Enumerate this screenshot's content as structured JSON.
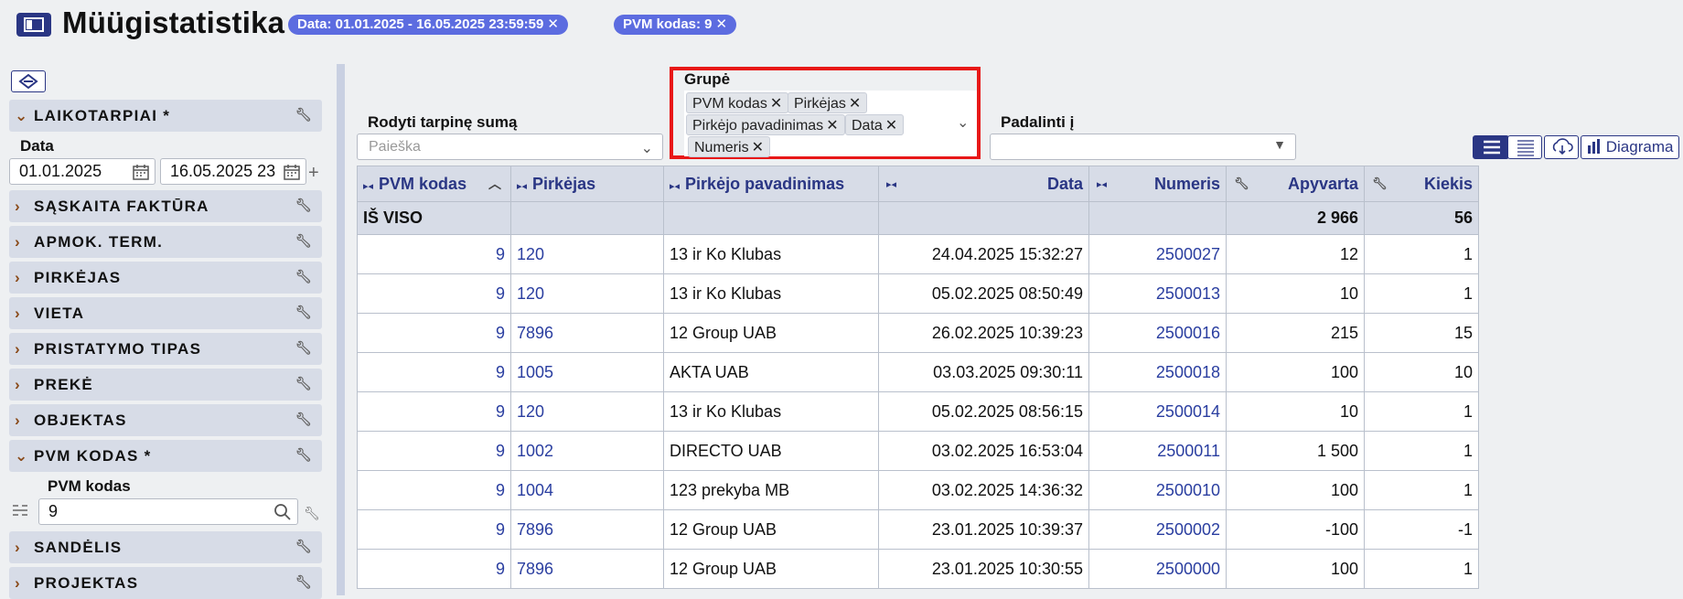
{
  "header": {
    "title": "Müügistatistika",
    "filters": [
      "Data: 01.01.2025 - 16.05.2025 23:59:59",
      "PVM kodas: 9"
    ],
    "chip_close": "✕"
  },
  "sidebar": {
    "sections": [
      {
        "label": "LAIKOTARPIAI *",
        "expanded": true
      },
      {
        "label": "SĄSKAITA FAKTŪRA",
        "expanded": false
      },
      {
        "label": "APMOK. TERM.",
        "expanded": false
      },
      {
        "label": "PIRKĖJAS",
        "expanded": false
      },
      {
        "label": "VIETA",
        "expanded": false
      },
      {
        "label": "PRISTATYMO TIPAS",
        "expanded": false
      },
      {
        "label": "PREKĖ",
        "expanded": false
      },
      {
        "label": "OBJEKTAS",
        "expanded": false
      },
      {
        "label": "PVM KODAS *",
        "expanded": true
      },
      {
        "label": "SANDĖLIS",
        "expanded": false
      },
      {
        "label": "PROJEKTAS",
        "expanded": false
      }
    ],
    "date_label": "Data",
    "date_from": "01.01.2025",
    "date_to": "16.05.2025 23",
    "pvm_label": "PVM kodas",
    "pvm_value": "9"
  },
  "controls": {
    "subtotal_label": "Rodyti tarpinę sumą",
    "subtotal_placeholder": "Paieška",
    "group_label": "Grupė",
    "group_tags": [
      "PVM kodas",
      "Pirkėjas",
      "Pirkėjo pavadinimas",
      "Data",
      "Numeris"
    ],
    "split_label": "Padalinti į",
    "diagram_label": "Diagrama"
  },
  "table": {
    "columns": [
      "PVM kodas",
      "Pirkėjas",
      "Pirkėjo pavadinimas",
      "Data",
      "Numeris",
      "Apyvarta",
      "Kiekis"
    ],
    "totals": {
      "label": "IŠ VISO",
      "apyvarta": "2 966",
      "kiekis": "56"
    },
    "rows": [
      [
        "9",
        "120",
        "13 ir Ko Klubas",
        "24.04.2025 15:32:27",
        "2500027",
        "12",
        "1"
      ],
      [
        "9",
        "120",
        "13 ir Ko Klubas",
        "05.02.2025 08:50:49",
        "2500013",
        "10",
        "1"
      ],
      [
        "9",
        "7896",
        "12 Group UAB",
        "26.02.2025 10:39:23",
        "2500016",
        "215",
        "15"
      ],
      [
        "9",
        "1005",
        "AKTA UAB",
        "03.03.2025 09:30:11",
        "2500018",
        "100",
        "10"
      ],
      [
        "9",
        "120",
        "13 ir Ko Klubas",
        "05.02.2025 08:56:15",
        "2500014",
        "10",
        "1"
      ],
      [
        "9",
        "1002",
        "DIRECTO UAB",
        "03.02.2025 16:53:04",
        "2500011",
        "1 500",
        "1"
      ],
      [
        "9",
        "1004",
        "123 prekyba MB",
        "03.02.2025 14:36:32",
        "2500010",
        "100",
        "1"
      ],
      [
        "9",
        "7896",
        "12 Group UAB",
        "23.01.2025 10:39:37",
        "2500002",
        "-100",
        "-1"
      ],
      [
        "9",
        "7896",
        "12 Group UAB",
        "23.01.2025 10:30:55",
        "2500000",
        "100",
        "1"
      ]
    ]
  },
  "colors": {
    "accent": "#2a3684",
    "chip": "#5c6ce0",
    "highlight": "#e81818",
    "header_bg": "#d7dce7"
  }
}
